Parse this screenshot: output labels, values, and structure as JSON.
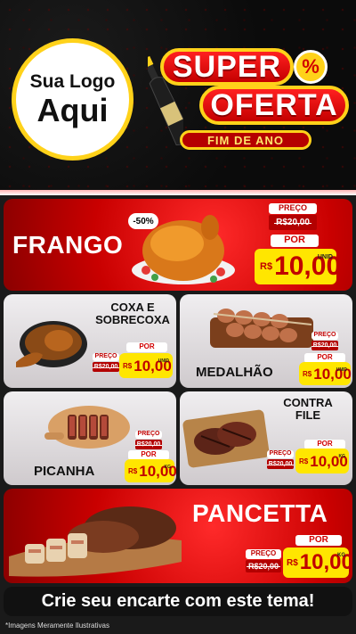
{
  "logo": {
    "line1": "Sua Logo",
    "line2": "Aqui"
  },
  "badge": {
    "super": "SUPER",
    "percent": "%",
    "oferta": "OFERTA",
    "subtitle": "FIM DE ANO"
  },
  "products": {
    "frango": {
      "name": "FRANGO",
      "discount": "-50%",
      "preco_label": "PREÇO",
      "old_price": "R$20,00",
      "por_label": "POR",
      "currency": "R$",
      "new_price": "10,00",
      "unit": "UNID"
    },
    "coxa": {
      "name_line1": "COXA E",
      "name_line2": "SOBRECOXA",
      "preco_label": "PREÇO",
      "old_price": "R$20,00",
      "por_label": "POR",
      "currency": "R$",
      "new_price": "10,00",
      "unit": "UNID"
    },
    "medalhao": {
      "name": "MEDALHÃO",
      "preco_label": "PREÇO",
      "old_price": "R$20,00",
      "por_label": "POR",
      "currency": "R$",
      "new_price": "10,00",
      "unit": "UNID"
    },
    "picanha": {
      "name": "PICANHA",
      "preco_label": "PREÇO",
      "old_price": "R$20,00",
      "por_label": "POR",
      "currency": "R$",
      "new_price": "10,00",
      "unit": "KG"
    },
    "contrafile": {
      "name_line1": "CONTRA",
      "name_line2": "FILE",
      "preco_label": "PREÇO",
      "old_price": "R$20,00",
      "por_label": "POR",
      "currency": "R$",
      "new_price": "10,00",
      "unit": "KG"
    },
    "pancetta": {
      "name": "PANCETTA",
      "preco_label": "PREÇO",
      "old_price": "R$20,00",
      "por_label": "POR",
      "currency": "R$",
      "new_price": "10,00",
      "unit": "KG"
    }
  },
  "cta": "Crie seu encarte com este tema!",
  "footnote": "*Imagens Meramente Ilustrativas",
  "colors": {
    "red": "#d10000",
    "yellow": "#ffe600",
    "gold": "#ffd21a"
  }
}
